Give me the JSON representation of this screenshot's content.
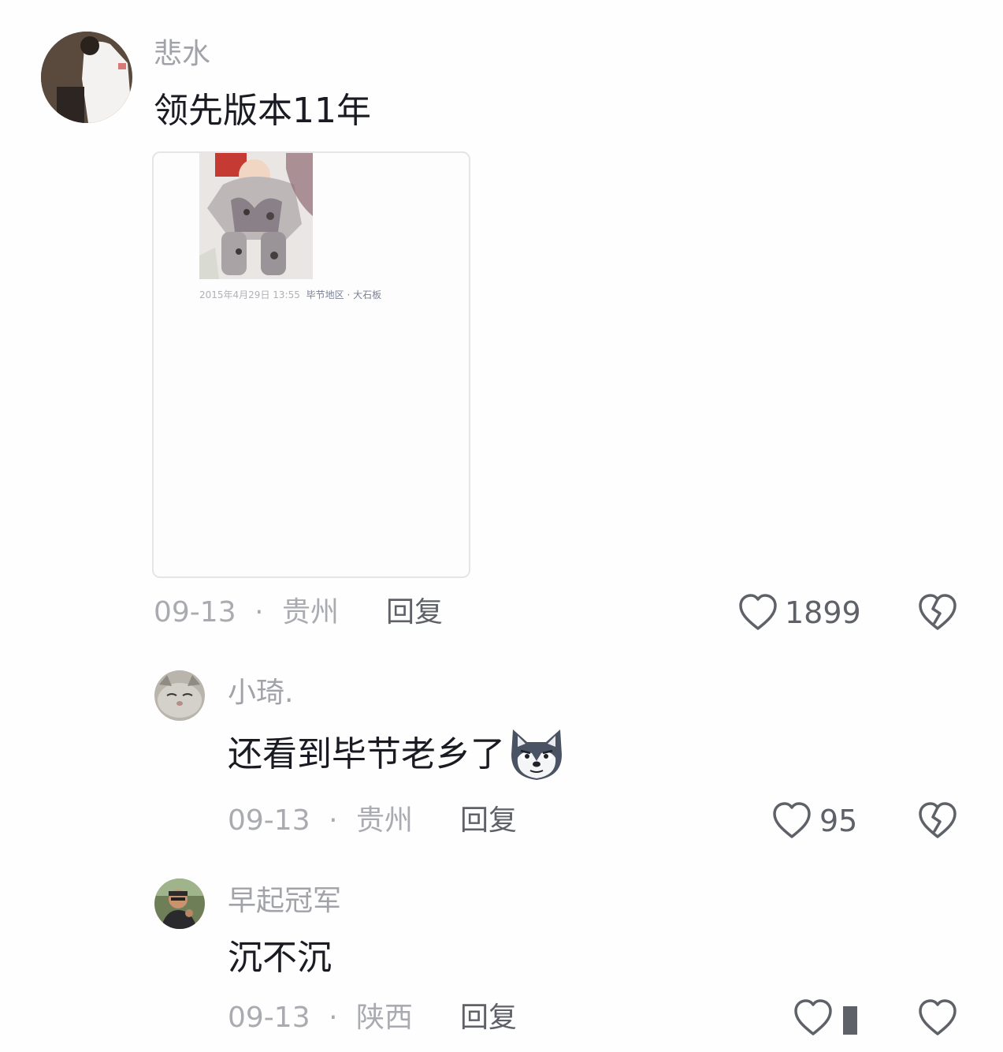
{
  "comments": [
    {
      "user": "悲水",
      "text": "领先版本11年",
      "date": "09-13",
      "separator": "·",
      "location": "贵州",
      "reply": "回复",
      "likes": "1899",
      "attachment": {
        "caption_date": "2015年4月29日 13:55",
        "caption_place": "毕节地区 · 大石板"
      }
    },
    {
      "user": "小琦.",
      "text": "还看到毕节老乡了",
      "date": "09-13",
      "separator": "·",
      "location": "贵州",
      "reply": "回复",
      "likes": "95"
    },
    {
      "user": "早起冠军",
      "text": "沉不沉",
      "date": "09-13",
      "separator": "·",
      "location": "陕西",
      "reply": "回复"
    }
  ],
  "colors": {
    "text": "#1a1b22",
    "muted": "#a9abb0",
    "icon": "#5f6168"
  },
  "icons": [
    "heart-icon",
    "dislike-heart-icon",
    "husky-emoji-icon"
  ]
}
